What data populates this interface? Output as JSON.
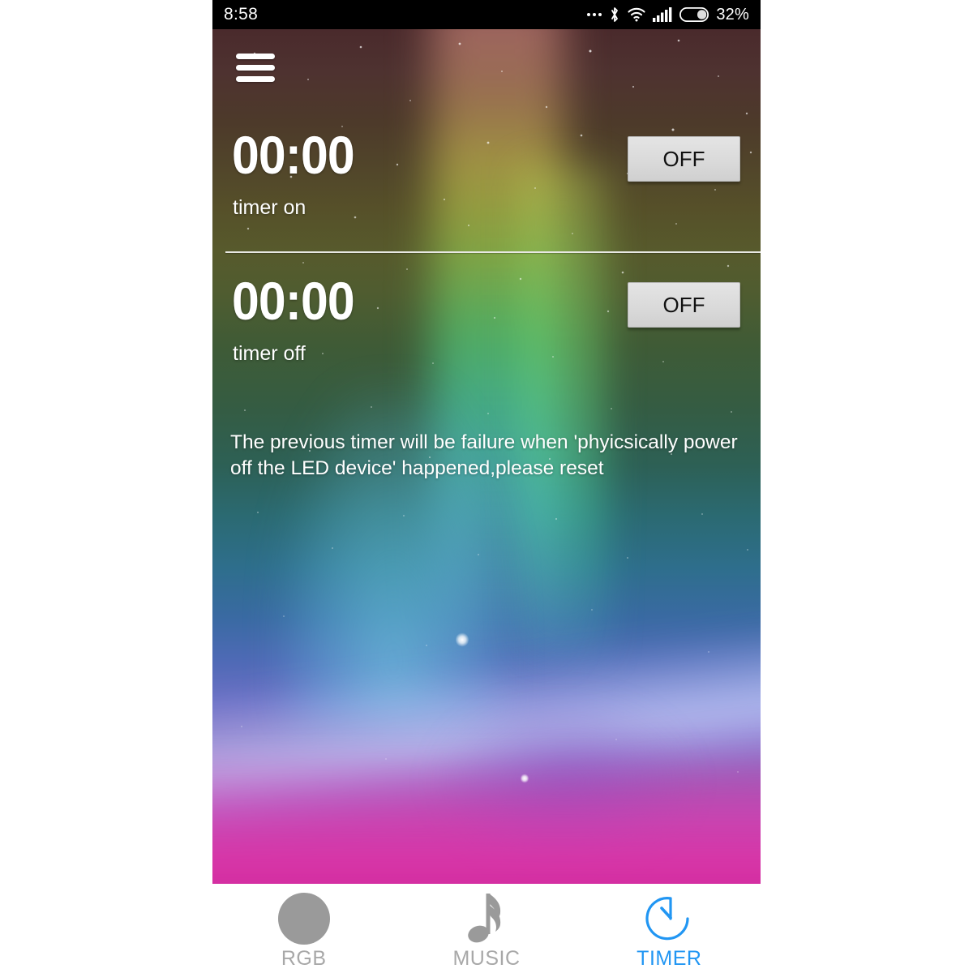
{
  "status_bar": {
    "time": "8:58",
    "battery_percent": "32%",
    "icons": [
      "more-dots-icon",
      "bluetooth-icon",
      "wifi-icon",
      "cellular-signal-icon",
      "battery-icon"
    ]
  },
  "app_bar": {
    "menu_icon": "hamburger-menu-icon"
  },
  "timers": [
    {
      "value": "00:00",
      "label": "timer on",
      "toggle_label": "OFF"
    },
    {
      "value": "00:00",
      "label": "timer off",
      "toggle_label": "OFF"
    }
  ],
  "note": "The previous timer will be failure when 'phyicsically power off the LED device' happened,please reset",
  "bottom_nav": {
    "items": [
      {
        "label": "RGB",
        "icon": "rgb-color-circle-icon",
        "active": false
      },
      {
        "label": "MUSIC",
        "icon": "music-note-icon",
        "active": false
      },
      {
        "label": "TIMER",
        "icon": "stopwatch-timer-icon",
        "active": true
      }
    ],
    "active_color": "#2196f3",
    "inactive_color": "#a8a8a8"
  },
  "colors": {
    "status_bar_bg": "#000000",
    "button_bg": "#dadada",
    "text_on_wallpaper": "#ffffff",
    "accent_blue": "#2196f3",
    "nav_bg": "#ffffff"
  }
}
